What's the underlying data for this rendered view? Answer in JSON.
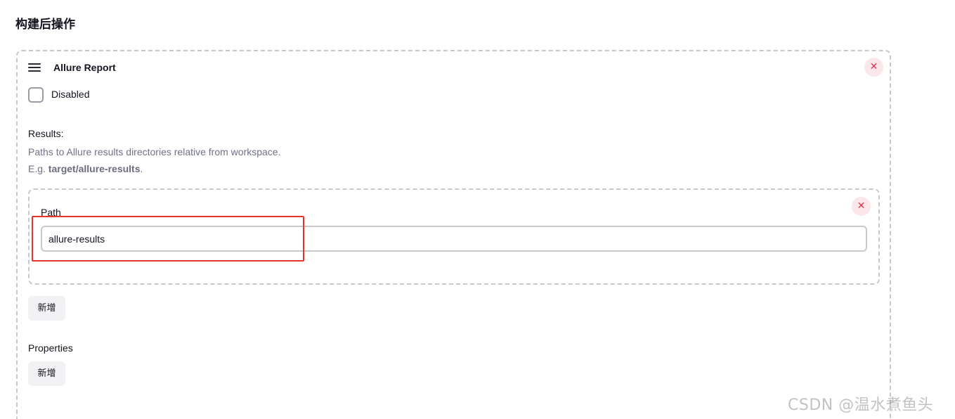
{
  "section": {
    "title": "构建后操作"
  },
  "step": {
    "title": "Allure Report",
    "remove_symbol": "✕",
    "disabled_label": "Disabled",
    "results_label": "Results:",
    "help_line1": "Paths to Allure results directories relative from workspace.",
    "help_prefix": "E.g. ",
    "help_example": "target/allure-results",
    "help_suffix": ".",
    "path_label": "Path",
    "path_value": "allure-results",
    "path_remove_symbol": "✕",
    "add_label": "新增",
    "properties_label": "Properties",
    "properties_add_label": "新增"
  },
  "watermark": "CSDN @温水煮鱼头",
  "colors": {
    "remove_bg": "#fbe6ea",
    "remove_fg": "#d63a52",
    "highlight": "#e8342b",
    "help_text": "#6f7287"
  }
}
